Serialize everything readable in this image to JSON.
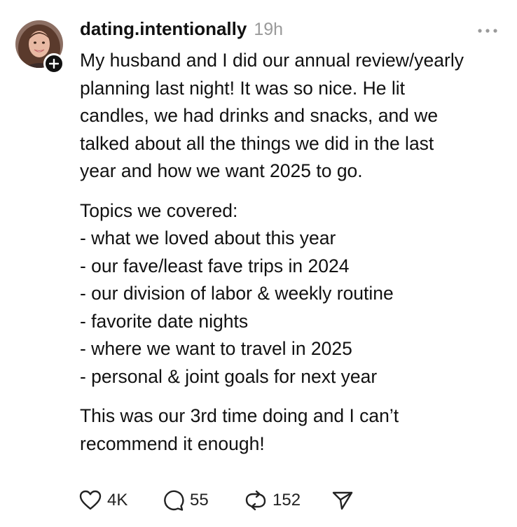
{
  "post": {
    "username": "dating.intentionally",
    "timestamp": "19h",
    "avatar_icon": "profile-photo",
    "follow_icon": "plus-icon",
    "more_icon": "more-icon",
    "paragraphs": [
      [
        "My husband and I did our annual review/yearly",
        "planning last night! It was so nice. He lit",
        "candles, we had drinks and snacks, and we",
        "talked about all the things we did in the last",
        "year and how we want 2025 to go."
      ],
      [
        "Topics we covered:",
        "- what we loved about this year",
        "- our fave/least fave trips in 2024",
        "- our division of labor & weekly routine",
        "- favorite date nights",
        "- where we want to travel in 2025",
        "- personal & joint goals for next year"
      ],
      [
        "This was our 3rd time doing and I can’t",
        "recommend it enough!"
      ]
    ],
    "actions": {
      "like_count": "4K",
      "reply_count": "55",
      "repost_count": "152"
    }
  },
  "colors": {
    "text": "#111111",
    "timestamp": "#9a9a9a",
    "icon": "#222222",
    "background": "#ffffff"
  }
}
